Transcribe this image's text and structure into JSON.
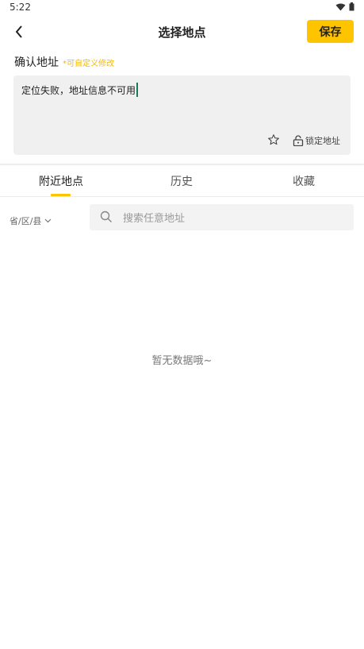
{
  "status_bar": {
    "time": "5:22"
  },
  "header": {
    "title": "选择地点",
    "save_label": "保存"
  },
  "confirm": {
    "title": "确认地址",
    "hint": "*可自定义修改"
  },
  "address": {
    "value": "定位失败，地址信息不可用",
    "lock_label": "锁定地址"
  },
  "tabs": [
    {
      "label": "附近地点",
      "active": true
    },
    {
      "label": "历史",
      "active": false
    },
    {
      "label": "收藏",
      "active": false
    }
  ],
  "region": {
    "label": "省/区/县"
  },
  "search": {
    "placeholder": "搜索任意地址"
  },
  "empty": {
    "message": "暂无数据哦~"
  },
  "colors": {
    "accent": "#ffc400",
    "hint": "#f5b800",
    "caret": "#1a7a5a"
  },
  "icons": [
    "wifi-icon",
    "battery-icon",
    "back-arrow-icon",
    "star-icon",
    "lock-icon",
    "chevron-down-icon",
    "search-icon"
  ]
}
